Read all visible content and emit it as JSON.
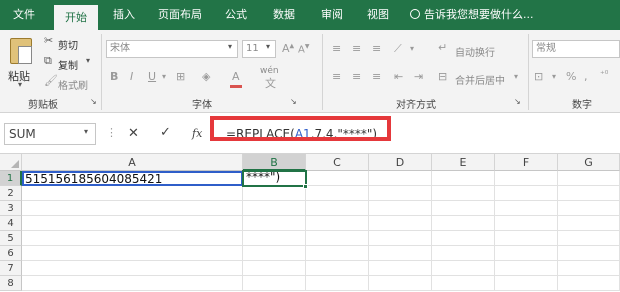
{
  "tabs": [
    "文件",
    "开始",
    "插入",
    "页面布局",
    "公式",
    "数据",
    "审阅",
    "视图"
  ],
  "tell_me": "告诉我您想要做什么...",
  "ribbon": {
    "paste": "粘贴",
    "cut": "剪切",
    "copy": "复制",
    "format_painter": "格式刷",
    "clipboard_group": "剪贴板",
    "font_name": "宋体",
    "font_size": "11",
    "font_group": "字体",
    "wen": "wén",
    "wrap_text": "自动换行",
    "merge_center": "合并后居中",
    "align_group": "对齐方式",
    "number_format": "常规",
    "number_group": "数字"
  },
  "formula_bar": {
    "name_box": "SUM",
    "fx": "fx",
    "formula_prefix": "=REPLACE(",
    "formula_ref": "A1",
    "formula_suffix": ",7,4,\"****\")"
  },
  "sheet": {
    "columns": [
      "A",
      "B",
      "C",
      "D",
      "E",
      "F",
      "G"
    ],
    "rows": [
      "1",
      "2",
      "3",
      "4",
      "5",
      "6",
      "7",
      "8"
    ],
    "a1": "515156185604085421",
    "b1": "****\")"
  },
  "colors": {
    "accent": "#217346",
    "highlight": "#e5383b"
  }
}
